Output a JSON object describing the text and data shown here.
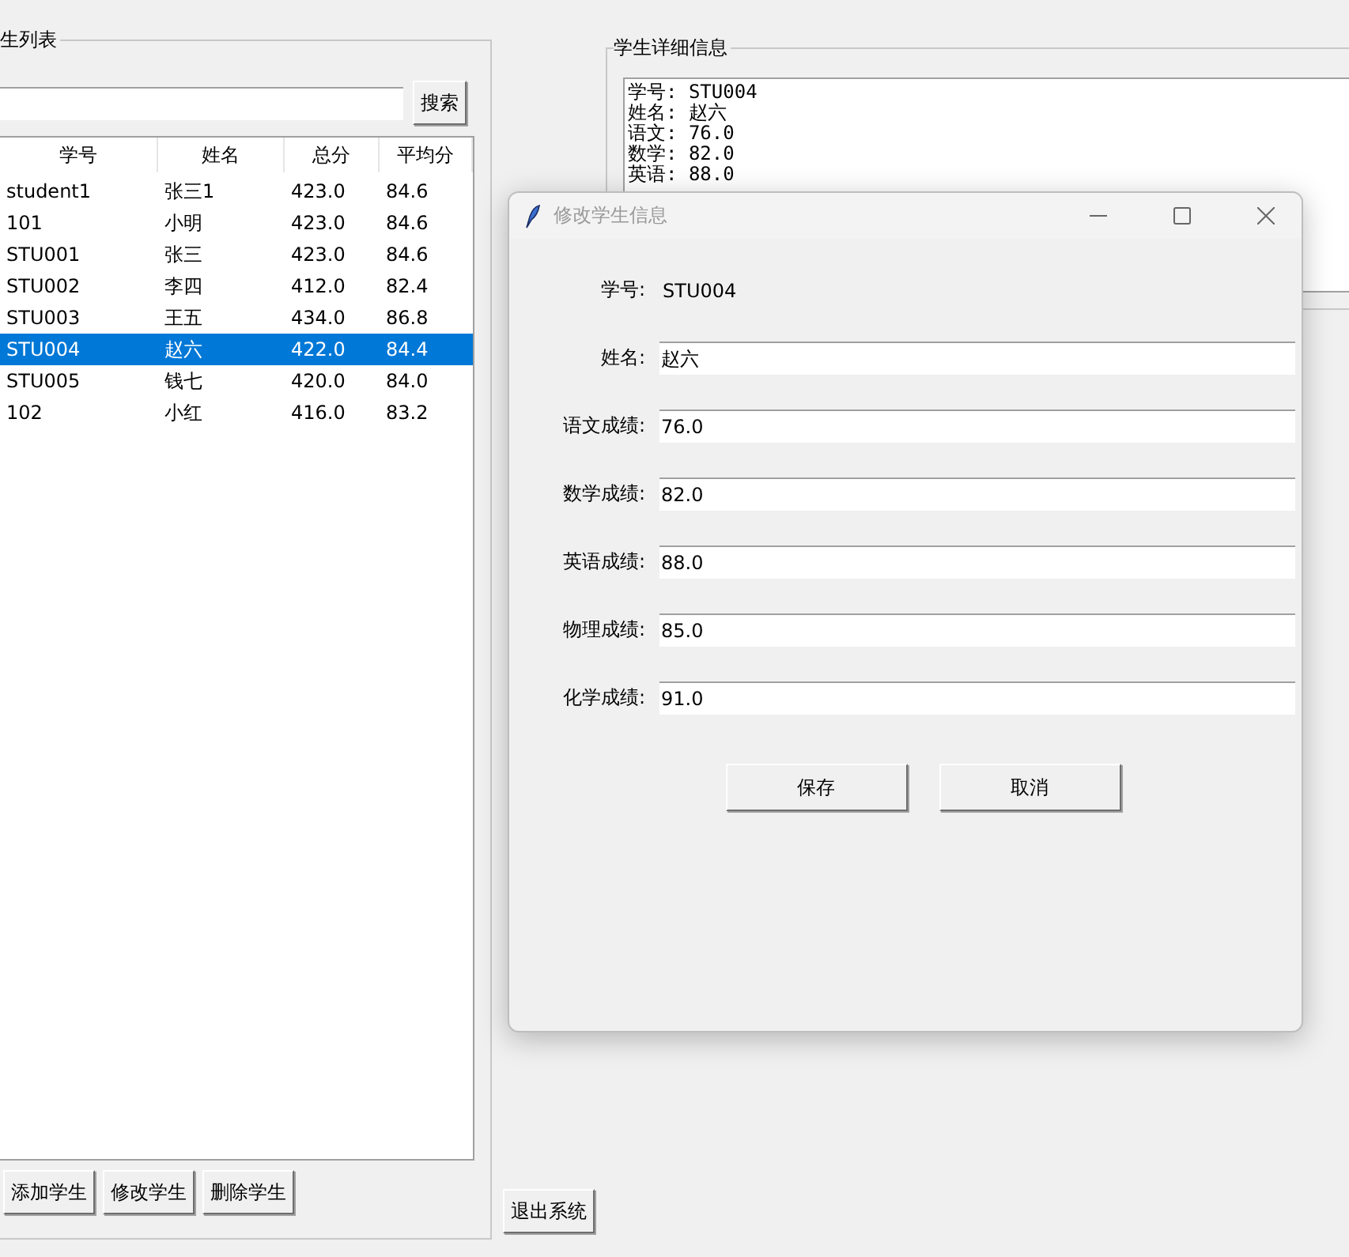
{
  "list_panel": {
    "title": "生列表",
    "search": {
      "button": "搜索"
    },
    "columns": [
      "学号",
      "姓名",
      "总分",
      "平均分"
    ],
    "rows": [
      {
        "cells": [
          "student1",
          "张三1",
          "423.0",
          "84.6"
        ],
        "selected": false
      },
      {
        "cells": [
          "101",
          "小明",
          "423.0",
          "84.6"
        ],
        "selected": false
      },
      {
        "cells": [
          "STU001",
          "张三",
          "423.0",
          "84.6"
        ],
        "selected": false
      },
      {
        "cells": [
          "STU002",
          "李四",
          "412.0",
          "82.4"
        ],
        "selected": false
      },
      {
        "cells": [
          "STU003",
          "王五",
          "434.0",
          "86.8"
        ],
        "selected": false
      },
      {
        "cells": [
          "STU004",
          "赵六",
          "422.0",
          "84.4"
        ],
        "selected": true
      },
      {
        "cells": [
          "STU005",
          "钱七",
          "420.0",
          "84.0"
        ],
        "selected": false
      },
      {
        "cells": [
          "102",
          "小红",
          "416.0",
          "83.2"
        ],
        "selected": false
      }
    ],
    "buttons": [
      "添加学生",
      "修改学生",
      "删除学生"
    ]
  },
  "detail_panel": {
    "title": "学生详细信息",
    "lines": [
      "学号: STU004",
      "姓名: 赵六",
      "语文: 76.0",
      "数学: 82.0",
      "英语: 88.0"
    ]
  },
  "exit_button": "退出系统",
  "dialog": {
    "title": "修改学生信息",
    "fields": [
      {
        "kind": "static",
        "label": "学号:",
        "value": "STU004"
      },
      {
        "kind": "entry",
        "label": "姓名:",
        "value": "赵六"
      },
      {
        "kind": "entry",
        "label": "语文成绩:",
        "value": "76.0"
      },
      {
        "kind": "entry",
        "label": "数学成绩:",
        "value": "82.0"
      },
      {
        "kind": "entry",
        "label": "英语成绩:",
        "value": "88.0"
      },
      {
        "kind": "entry",
        "label": "物理成绩:",
        "value": "85.0"
      },
      {
        "kind": "entry",
        "label": "化学成绩:",
        "value": "91.0"
      }
    ],
    "buttons": [
      "保存",
      "取消"
    ]
  }
}
